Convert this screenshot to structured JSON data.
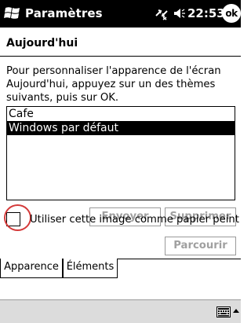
{
  "status_bar": {
    "title": "Paramètres",
    "time": "22:53",
    "ok_label": "ok",
    "icons": [
      "windows-start-icon",
      "connectivity-icon",
      "volume-icon"
    ]
  },
  "header": {
    "title": "Aujourd'hui"
  },
  "description": "Pour personnaliser l'apparence de l'écran Aujourd'hui, appuyez sur un des thèmes suivants, puis sur OK.",
  "themes": [
    {
      "label": "Cafe",
      "selected": false
    },
    {
      "label": "Windows par défaut",
      "selected": true
    }
  ],
  "buttons": {
    "send": "Envoyer",
    "delete": "Supprimer",
    "browse": "Parcourir"
  },
  "wallpaper": {
    "label": "Utiliser cette image comme papier peint",
    "checked": false
  },
  "tabs": [
    {
      "label": "Apparence",
      "active": true
    },
    {
      "label": "Éléments",
      "active": false
    }
  ],
  "command_bar": {
    "icons": [
      "keyboard-icon",
      "sip-arrow-icon"
    ]
  },
  "colors": {
    "highlight_circle": "#d43a3a",
    "disabled_text": "#a0a0a0"
  }
}
